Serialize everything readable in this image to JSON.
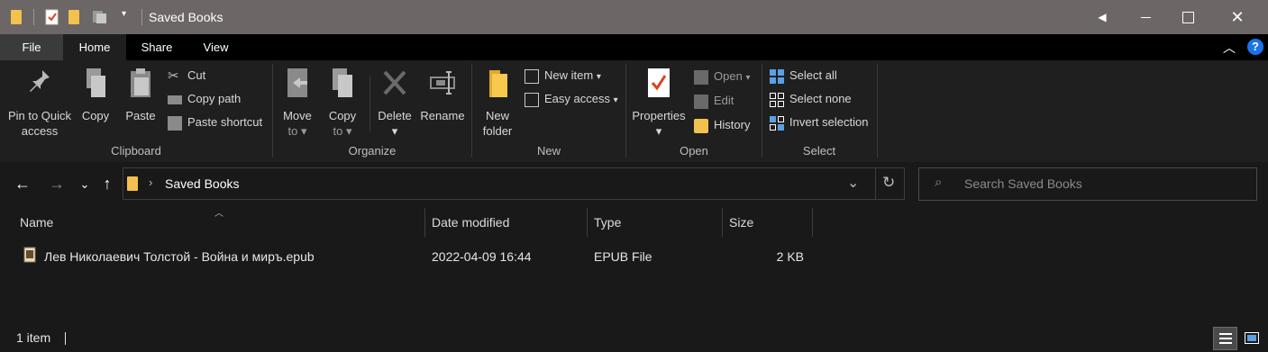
{
  "window": {
    "title": "Saved Books",
    "colors": {
      "titlebar": "#6d6666",
      "ribbon": "#1f1f1f",
      "background": "#191919",
      "accent": "#1a73e8"
    }
  },
  "titlebar": {
    "quick_access_icons": [
      "folder-icon",
      "properties-check-icon",
      "folder-icon",
      "view-options-icon",
      "dropdown-arrow-icon"
    ],
    "controls": [
      "chevron-left-icon",
      "minimize-icon",
      "maximize-icon",
      "close-icon"
    ]
  },
  "tabs": [
    {
      "label": "File"
    },
    {
      "label": "Home"
    },
    {
      "label": "Share"
    },
    {
      "label": "View"
    }
  ],
  "ribbon": {
    "clipboard": {
      "label": "Clipboard",
      "pin": "Pin to Quick access",
      "pin_line1": "Pin to Quick",
      "pin_line2": "access",
      "copy": "Copy",
      "paste": "Paste",
      "cut": "Cut",
      "copy_path": "Copy path",
      "paste_shortcut": "Paste shortcut"
    },
    "organize": {
      "label": "Organize",
      "move_line1": "Move",
      "move_line2": "to",
      "copy_line1": "Copy",
      "copy_line2": "to",
      "delete": "Delete",
      "rename": "Rename"
    },
    "new": {
      "label": "New",
      "new_folder_line1": "New",
      "new_folder_line2": "folder",
      "new_item": "New item",
      "easy_access": "Easy access"
    },
    "open": {
      "label": "Open",
      "properties": "Properties",
      "open": "Open",
      "edit": "Edit",
      "history": "History"
    },
    "select": {
      "label": "Select",
      "select_all": "Select all",
      "select_none": "Select none",
      "invert_selection": "Invert selection"
    }
  },
  "address": {
    "path": "Saved Books",
    "search_placeholder": "Search Saved Books"
  },
  "columns": [
    "Name",
    "Date modified",
    "Type",
    "Size"
  ],
  "files": [
    {
      "name": "Лев Николаевич Толстой - Война и миръ.epub",
      "date_modified": "2022-04-09 16:44",
      "type": "EPUB File",
      "size": "2 KB"
    }
  ],
  "status": {
    "item_count": "1 item"
  }
}
